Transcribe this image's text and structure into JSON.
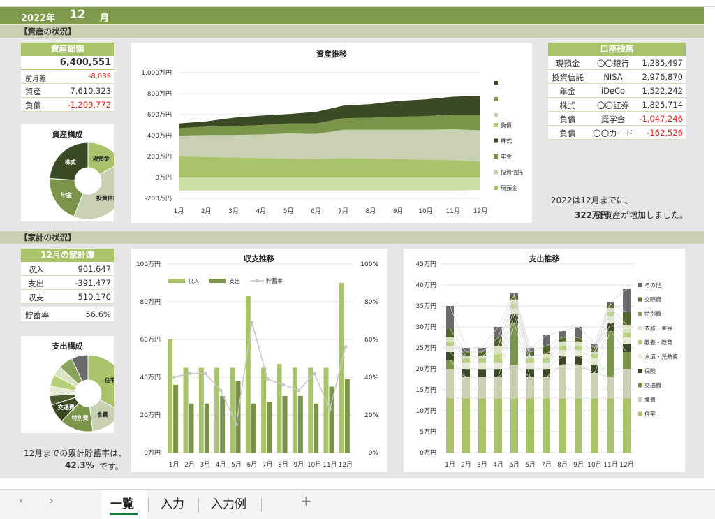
{
  "title": {
    "year": "2022年",
    "month": "12",
    "month_suffix": "月"
  },
  "sections": {
    "assets": "【資産の状況】",
    "household": "【家計の状況】"
  },
  "asset_total": {
    "header": "資産総額",
    "value": "6,400,551",
    "rows": [
      {
        "label": "前月差",
        "value": "-8,039"
      },
      {
        "label": "資産",
        "value": "7,610,323"
      },
      {
        "label": "負債",
        "value": "-1,209,772"
      }
    ]
  },
  "accounts": {
    "header": "口座残高",
    "rows": [
      {
        "type": "現預金",
        "name": "〇〇銀行",
        "value": "1,285,497"
      },
      {
        "type": "投資信託",
        "name": "NISA",
        "value": "2,976,870"
      },
      {
        "type": "年金",
        "name": "iDeCo",
        "value": "1,522,242"
      },
      {
        "type": "株式",
        "name": "〇〇証券",
        "value": "1,825,714"
      },
      {
        "type": "負債",
        "name": "奨学金",
        "value": "-1,047,246"
      },
      {
        "type": "負債",
        "name": "〇〇カード",
        "value": "-162,526"
      }
    ]
  },
  "asset_note": {
    "line1": "2022は12月までに、",
    "amount": "322万円",
    "line2": "総資産が増加しました。"
  },
  "household": {
    "header": "12月の家計簿",
    "rows": [
      {
        "label": "収入",
        "value": "901,647"
      },
      {
        "label": "支出",
        "value": "-391,477"
      },
      {
        "label": "収支",
        "value": "510,170"
      }
    ],
    "saving_label": "貯蓄率",
    "saving_value": "56.6%"
  },
  "saving_note": {
    "line1": "12月までの累計貯蓄率は、",
    "amount": "42.3%",
    "line2": "です。"
  },
  "tabs": {
    "sheet1": "一覧",
    "sheet2": "入力",
    "sheet3": "入力例",
    "add": "+",
    "prev": "‹",
    "next": "›"
  },
  "chart_data": [
    {
      "type": "area",
      "title": "資産推移",
      "categories": [
        "1月",
        "2月",
        "3月",
        "4月",
        "5月",
        "6月",
        "7月",
        "8月",
        "9月",
        "10月",
        "11月",
        "12月"
      ],
      "ytick_labels": [
        "1,000万円",
        "800万円",
        "600万円",
        "400万円",
        "200万円",
        "0万円",
        "-200万円"
      ],
      "ylim": [
        -200,
        1000
      ],
      "legend": [
        "負債",
        "株式",
        "年金",
        "投資信託",
        "現預金"
      ],
      "series": [
        {
          "name": "現預金",
          "color": "#a9c36b",
          "values": [
            200,
            195,
            190,
            185,
            180,
            175,
            185,
            180,
            175,
            170,
            165,
            150
          ]
        },
        {
          "name": "投資信託",
          "color": "#c9d1b2",
          "values": [
            200,
            210,
            215,
            225,
            240,
            240,
            270,
            275,
            280,
            285,
            295,
            300
          ]
        },
        {
          "name": "年金",
          "color": "#7a9449",
          "values": [
            70,
            80,
            85,
            90,
            95,
            100,
            110,
            115,
            125,
            130,
            140,
            150
          ]
        },
        {
          "name": "株式",
          "color": "#3b4a24",
          "values": [
            45,
            50,
            80,
            90,
            90,
            110,
            120,
            130,
            150,
            160,
            170,
            180
          ]
        },
        {
          "name": "負債",
          "color": "#b6d07a",
          "values": [
            -125,
            -125,
            -125,
            -125,
            -125,
            -125,
            -125,
            -125,
            -125,
            -125,
            -125,
            -121
          ]
        }
      ]
    },
    {
      "type": "pie",
      "title": "資産構成",
      "labels": [
        "現預金",
        "投資信託",
        "年金",
        "株式"
      ],
      "values": [
        1285497,
        2976870,
        1522242,
        1825714
      ],
      "colors": [
        "#a9c36b",
        "#c9d1b2",
        "#7a9449",
        "#3b4a24"
      ]
    },
    {
      "type": "bar",
      "title": "収支推移",
      "categories": [
        "1月",
        "2月",
        "3月",
        "4月",
        "5月",
        "6月",
        "7月",
        "8月",
        "9月",
        "10月",
        "11月",
        "12月"
      ],
      "ytick_labels": [
        "100万円",
        "80万円",
        "60万円",
        "40万円",
        "20万円",
        "0万円"
      ],
      "y2tick_labels": [
        "100%",
        "80%",
        "60%",
        "40%",
        "20%",
        "0%"
      ],
      "legend": [
        "収入",
        "支出",
        "貯蓄率"
      ],
      "series": [
        {
          "name": "収入",
          "color": "#a9c36b",
          "values": [
            60,
            45,
            45,
            45,
            45,
            83,
            45,
            47,
            45,
            45,
            45,
            90
          ]
        },
        {
          "name": "支出",
          "color": "#7a9449",
          "values": [
            36,
            26,
            26,
            30,
            38,
            26,
            27,
            30,
            30,
            26,
            35,
            39
          ]
        },
        {
          "name": "貯蓄率",
          "color": "#c8c8c8",
          "values": [
            40,
            42,
            42,
            33,
            15,
            69,
            39,
            36,
            33,
            42,
            23,
            56
          ]
        }
      ]
    },
    {
      "type": "pie",
      "title": "支出構成",
      "labels": [
        "住宅",
        "食費",
        "特別費",
        "交通費",
        "保険",
        "水道・光熱費",
        "教養・教育",
        "衣服・美容",
        "交際費",
        "その他"
      ],
      "values": [
        33,
        15,
        14,
        8,
        4,
        4,
        5,
        4,
        6,
        7
      ],
      "colors": [
        "#a9c36b",
        "#c9d1b2",
        "#7a9449",
        "#3b4a24",
        "#4a5a2c",
        "#e5ead5",
        "#b6d07a",
        "#d9e3c0",
        "#8aa35c",
        "#6b6b6b"
      ]
    },
    {
      "type": "bar",
      "title": "支出推移",
      "categories": [
        "1月",
        "2月",
        "3月",
        "4月",
        "5月",
        "6月",
        "7月",
        "8月",
        "9月",
        "10月",
        "11月",
        "12月"
      ],
      "ytick_labels": [
        "45万円",
        "40万円",
        "35万円",
        "30万円",
        "25万円",
        "20万円",
        "15万円",
        "10万円",
        "5万円",
        "0万円"
      ],
      "ylim": [
        0,
        45
      ],
      "legend": [
        "その他",
        "交際費",
        "特別費",
        "衣服・美容",
        "教養・教育",
        "水道・光熱費",
        "保険",
        "交通費",
        "食費",
        "住宅"
      ],
      "series": [
        {
          "name": "住宅",
          "color": "#a9c36b",
          "values": [
            13,
            13,
            13,
            13,
            13,
            13,
            13,
            13,
            13,
            13,
            13,
            13
          ]
        },
        {
          "name": "食費",
          "color": "#c9d1b2",
          "values": [
            7,
            5,
            5,
            5,
            8,
            5,
            5,
            8,
            8,
            6,
            5,
            7
          ]
        },
        {
          "name": "交通費",
          "color": "#7a9449",
          "values": [
            2,
            0,
            0,
            0,
            10,
            0,
            0,
            0,
            0,
            0,
            11,
            4
          ]
        },
        {
          "name": "保険",
          "color": "#3b4a24",
          "values": [
            2,
            2,
            2,
            2,
            2,
            2,
            2,
            2,
            2,
            2,
            2,
            2
          ]
        },
        {
          "name": "水道・光熱費",
          "color": "#e5ead5",
          "values": [
            1.5,
            1.5,
            1.5,
            1.5,
            1.5,
            1.5,
            1.5,
            1.5,
            1.5,
            1.5,
            1.5,
            1.5
          ]
        },
        {
          "name": "教養・教育",
          "color": "#b6d07a",
          "values": [
            1,
            1,
            1,
            2,
            1,
            1,
            1,
            1,
            1,
            1,
            1,
            1
          ]
        },
        {
          "name": "衣服・美容",
          "color": "#d9e3c0",
          "values": [
            1,
            0.5,
            0.5,
            2,
            1,
            0.5,
            1,
            1,
            1,
            0.5,
            1,
            2
          ]
        },
        {
          "name": "特別費",
          "color": "#8aa35c",
          "values": [
            0,
            0,
            0,
            0,
            0,
            0,
            0,
            0,
            0,
            0,
            0,
            0
          ]
        },
        {
          "name": "交際費",
          "color": "#55652f",
          "values": [
            2,
            1,
            1,
            2,
            1,
            1,
            2,
            1,
            1,
            1,
            1,
            3
          ]
        },
        {
          "name": "その他",
          "color": "#6b6b6b",
          "values": [
            5.5,
            1,
            1,
            2.5,
            0.5,
            1,
            2.5,
            1.5,
            2.5,
            1,
            0.5,
            5.5
          ]
        }
      ]
    }
  ]
}
